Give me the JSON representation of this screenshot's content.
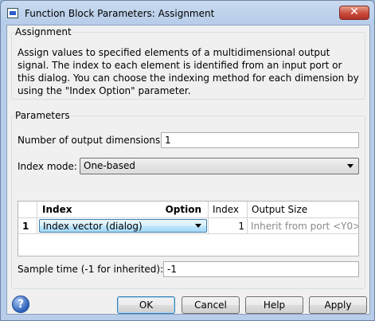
{
  "window": {
    "title": "Function Block Parameters: Assignment",
    "close_glyph": "✕"
  },
  "assignment": {
    "group_title": "Assignment",
    "description": "Assign values to specified elements of a multidimensional output signal. The index to each element is identified from an input port or this dialog. You can choose the indexing method for each dimension by using the \"Index Option\" parameter."
  },
  "parameters": {
    "group_title": "Parameters",
    "num_dims_label": "Number of output dimensions:",
    "num_dims_value": "1",
    "index_mode_label": "Index mode:",
    "index_mode_value": "One-based",
    "table": {
      "headers": {
        "index_option_left": "Index",
        "index_option_right": "Option",
        "index": "Index",
        "output_size": "Output Size"
      },
      "rows": [
        {
          "row_num": "1",
          "index_option": "Index vector (dialog)",
          "index": "1",
          "output_size": "Inherit from port <Y0>"
        }
      ]
    },
    "sample_time_label": "Sample time (-1 for inherited):",
    "sample_time_value": "-1"
  },
  "buttons": {
    "ok": "OK",
    "cancel": "Cancel",
    "help": "Help",
    "apply": "Apply"
  },
  "icons": {
    "help": "help-icon",
    "app": "simulink-block-icon"
  }
}
